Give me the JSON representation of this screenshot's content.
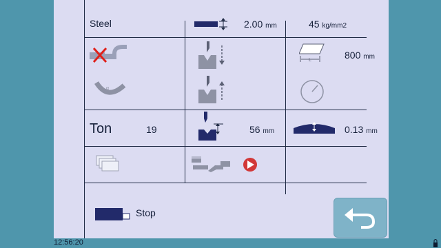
{
  "material": {
    "name": "Steel"
  },
  "thickness": {
    "value": "2.00",
    "unit": "mm"
  },
  "strength": {
    "value": "45",
    "unit": "kg/mm2"
  },
  "length": {
    "value": "800",
    "unit": "mm"
  },
  "force": {
    "label": "Ton",
    "value": "19"
  },
  "die_opening": {
    "value": "56",
    "unit": "mm"
  },
  "crowning": {
    "value": "0.13",
    "unit": "mm"
  },
  "footer": {
    "stop_label": "Stop"
  },
  "status": {
    "clock": "12:56:20"
  },
  "colors": {
    "accent": "#4f96ac",
    "panel": "#dcdcf2",
    "line": "#1f2a44",
    "alert": "#e0201a"
  },
  "icons": [
    "play-icon",
    "small-play-icon",
    "bend-disabled-icon",
    "bend-angle-icon",
    "punch-down-icon",
    "punch-up-icon",
    "sheet-length-icon",
    "clock-dial-icon",
    "punch-die-icon",
    "crowning-icon",
    "stack-icon",
    "tool-sequence-icon",
    "red-play-icon",
    "backgauge-icon",
    "back-arrow-icon"
  ]
}
